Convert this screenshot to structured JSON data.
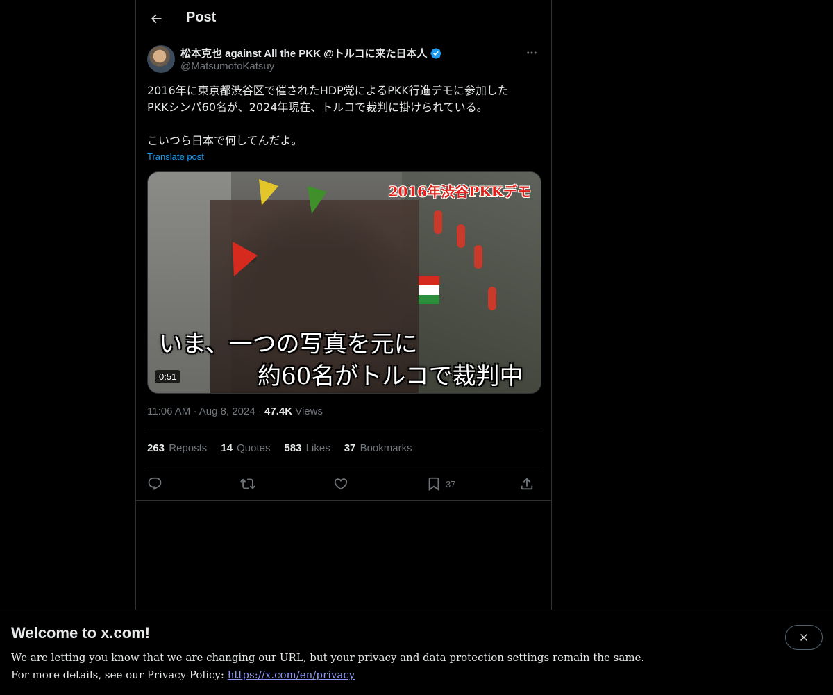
{
  "header": {
    "title": "Post"
  },
  "author": {
    "display_name": "松本克也 against All the PKK @トルコに来た日本人",
    "handle": "@MatsumotoKatsuy"
  },
  "post": {
    "text": "2016年に東京都渋谷区で催されたHDP党によるPKK行進デモに参加した\nPKKシンパ60名が、2024年現在、トルコで裁判に掛けられている。\n\nこいつら日本で何してんだよ。",
    "translate_label": "Translate post",
    "media": {
      "overlay_title": "2016年渋谷PKKデモ",
      "caption_line1": "いま、一つの写真を元に",
      "caption_line2": "約60名がトルコで裁判中",
      "duration": "0:51"
    },
    "time": "11:06 AM",
    "date": "Aug 8, 2024",
    "views_count": "47.4K",
    "views_label": "Views"
  },
  "stats": {
    "reposts_count": "263",
    "reposts_label": "Reposts",
    "quotes_count": "14",
    "quotes_label": "Quotes",
    "likes_count": "583",
    "likes_label": "Likes",
    "bookmarks_count": "37",
    "bookmarks_label": "Bookmarks"
  },
  "actions": {
    "bookmark_count": "37"
  },
  "banner": {
    "title": "Welcome to x.com!",
    "line1": "We are letting you know that we are changing our URL, but your privacy and data protection settings remain the same.",
    "line2_prefix": "For more details, see our Privacy Policy: ",
    "link": "https://x.com/en/privacy"
  },
  "colors": {
    "accent": "#1d9bf0",
    "muted": "#71767b",
    "text": "#e7e9ea",
    "background": "#000000"
  }
}
